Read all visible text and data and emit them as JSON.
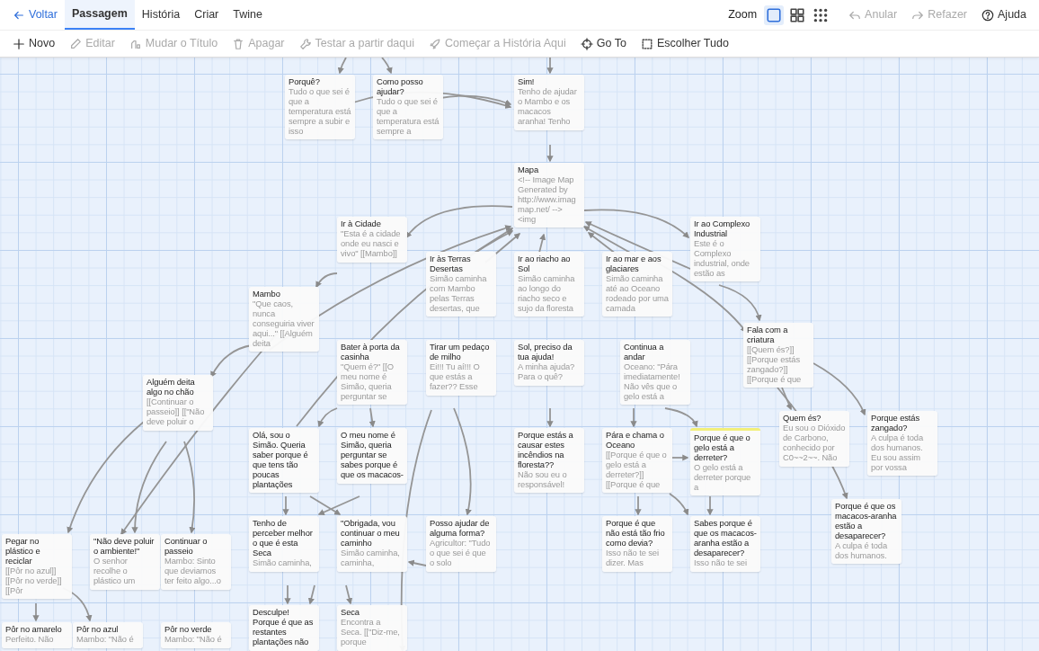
{
  "top_bar": {
    "back_link": "Voltar",
    "tabs": [
      {
        "label": "Passagem",
        "selected": true
      },
      {
        "label": "História",
        "selected": false
      },
      {
        "label": "Criar",
        "selected": false
      },
      {
        "label": "Twine",
        "selected": false
      }
    ],
    "zoom_label": "Zoom",
    "zoom_options": [
      {
        "selected": true
      },
      {
        "selected": false
      },
      {
        "selected": false
      }
    ],
    "actions": [
      {
        "label": "Anular",
        "disabled": true
      },
      {
        "label": "Refazer",
        "disabled": true
      },
      {
        "label": "Ajuda",
        "disabled": false
      }
    ]
  },
  "toolbar": [
    {
      "label": "Novo",
      "disabled": false
    },
    {
      "label": "Editar",
      "disabled": true
    },
    {
      "label": "Mudar o Título",
      "disabled": true
    },
    {
      "label": "Apagar",
      "disabled": true
    },
    {
      "label": "Testar a partir daqui",
      "disabled": true
    },
    {
      "label": "Começar a História Aqui",
      "disabled": true
    },
    {
      "label": "Go To",
      "disabled": false
    },
    {
      "label": "Escolher Tudo",
      "disabled": false
    }
  ],
  "passages": [
    {
      "title": "Porquê?",
      "excerpt": "Tudo o que sei é que a temperatura está sempre a subir e isso",
      "highlighted": false
    },
    {
      "title": "Como posso ajudar?",
      "excerpt": "Tudo o que sei é que a temperatura está sempre a",
      "highlighted": false
    },
    {
      "title": "Sim!",
      "excerpt": "Tenho de ajudar o Mambo e os macacos aranha! Tenho",
      "highlighted": false
    },
    {
      "title": "Mapa",
      "excerpt": "<!-- Image Map Generated by http://www.imag map.net/ --> <img",
      "highlighted": false
    },
    {
      "title": "Ir à Cidade",
      "excerpt": "\"Esta é a cidade onde eu nasci e vivo\" [[Mambo]]",
      "highlighted": false
    },
    {
      "title": "Ir ao Complexo Industrial",
      "excerpt": "Este é o Complexo industrial, onde estão as",
      "highlighted": false
    },
    {
      "title": "Ir às Terras Desertas",
      "excerpt": "Simão caminha com Mambo pelas Terras desertas, que",
      "highlighted": false
    },
    {
      "title": "Ir ao riacho ao Sol",
      "excerpt": "Simão caminha ao longo do riacho seco e sujo da floresta",
      "highlighted": false
    },
    {
      "title": "Ir ao mar e aos glaciares",
      "excerpt": "Simão caminha até ao Oceano rodeado por uma camada",
      "highlighted": false
    },
    {
      "title": "Mambo",
      "excerpt": "\"Que caos, nunca conseguiria viver aqui...\" [[Alguém deita",
      "highlighted": false
    },
    {
      "title": "Fala com a criatura",
      "excerpt": "[[Quem és?]] [[Porque estás zangado?]] [[Porque é que",
      "highlighted": false
    },
    {
      "title": "Bater à porta da casinha",
      "excerpt": "\"Quem é?\" [[O meu nome é Simão, queria perguntar se",
      "highlighted": false
    },
    {
      "title": "Tirar um pedaço de milho",
      "excerpt": "Ei!!! Tu aí!!! O que estás a fazer?? Esse",
      "highlighted": false
    },
    {
      "title": "Sol, preciso da tua ajuda!",
      "excerpt": "A minha ajuda? Para o quê?",
      "highlighted": false
    },
    {
      "title": "Continua a andar",
      "excerpt": "Oceano: \"Pára imediatamente! Não vês que o gelo está a",
      "highlighted": false
    },
    {
      "title": "Alguém deita algo no chão",
      "excerpt": "[[Continuar o passeio]] [[\"Não deve poluir o",
      "highlighted": false
    },
    {
      "title": "Quem és?",
      "excerpt": "Eu sou o Dióxido de Carbono, conhecido por C0~~2~~. Não",
      "highlighted": false
    },
    {
      "title": "Porque estás zangado?",
      "excerpt": "A culpa é toda dos humanos. Eu sou assim por vossa",
      "highlighted": false
    },
    {
      "title": "Olá, sou o Simão. Queria saber porque é que tens tão poucas plantações",
      "highlighted": false
    },
    {
      "title": "O meu nome é Simão, queria perguntar se sabes porque é que os macacos-",
      "highlighted": false
    },
    {
      "title": "Porque estás a causar estes incêndios na floresta??",
      "excerpt": "Não sou eu o responsável!",
      "highlighted": false
    },
    {
      "title": "Pára e chama o Oceano",
      "excerpt": "[[Porque é que o gelo está a derreter?]] [[Porque é que",
      "highlighted": false
    },
    {
      "title": "Porque é que o gelo está a derreter?",
      "excerpt": "O gelo está a derreter porque a",
      "highlighted": true
    },
    {
      "title": "Porque é que os macacos-aranha estão a desaparecer?",
      "excerpt": "A culpa é toda dos humanos.",
      "highlighted": false
    },
    {
      "title": "Pegar no plástico e reciclar",
      "excerpt": "[[Pôr no azul]] [[Pôr no verde]] [[Pôr",
      "highlighted": false
    },
    {
      "title": "\"Não deve poluir o ambiente!\"",
      "excerpt": "O senhor recolhe o plástico um",
      "highlighted": false
    },
    {
      "title": "Continuar o passeio",
      "excerpt": "Mambo: Sinto que deviamos ter feito algo...o",
      "highlighted": false
    },
    {
      "title": "Tenho de perceber melhor o que é esta Seca",
      "excerpt": "Simão caminha,",
      "highlighted": false
    },
    {
      "title": "\"Obrigada, vou continuar o meu caminho",
      "excerpt": "Simão caminha, caminha,",
      "highlighted": false
    },
    {
      "title": "Posso ajudar de alguma forma?",
      "excerpt": "Agricultor: \"Tudo o que sei é que o solo",
      "highlighted": false
    },
    {
      "title": "Porque é que não está tão frio como devia?",
      "excerpt": "Isso não te sei dizer. Mas",
      "highlighted": false
    },
    {
      "title": "Sabes porque é que os macacos-aranha estão a desaparecer?",
      "excerpt": "Isso não te sei",
      "highlighted": false
    },
    {
      "title": "Pôr no amarelo",
      "excerpt": "Perfeito. Não",
      "highlighted": false
    },
    {
      "title": "Pôr no azul",
      "excerpt": "Mambo: \"Não é",
      "highlighted": false
    },
    {
      "title": "Pôr no verde",
      "excerpt": "Mambo: \"Não é",
      "highlighted": false
    },
    {
      "title": "Desculpe! Porque é que as restantes plantações não",
      "highlighted": false
    },
    {
      "title": "Seca",
      "excerpt": "Encontra a Seca. [[\"Diz-me, porque",
      "highlighted": false
    }
  ]
}
